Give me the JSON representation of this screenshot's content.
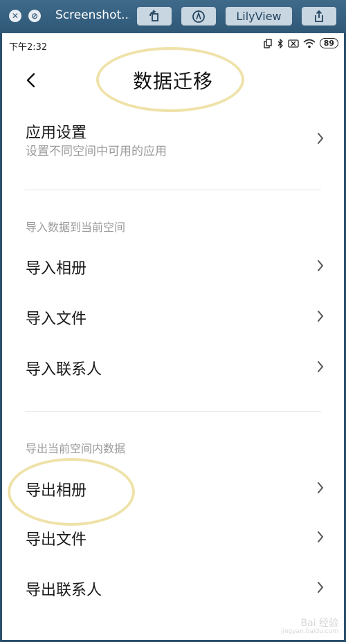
{
  "window": {
    "title": "Screenshot...",
    "lilyview_label": "LilyView",
    "close_glyph": "✕",
    "minimize_glyph": "⊘"
  },
  "status_bar": {
    "time": "下午2:32",
    "battery": "89"
  },
  "header": {
    "title": "数据迁移"
  },
  "app_settings": {
    "label": "应用设置",
    "subtitle": "设置不同空间中可用的应用"
  },
  "import_section": {
    "heading": "导入数据到当前空间",
    "items": [
      {
        "label": "导入相册"
      },
      {
        "label": "导入文件"
      },
      {
        "label": "导入联系人"
      }
    ]
  },
  "export_section": {
    "heading": "导出当前空间内数据",
    "items": [
      {
        "label": "导出相册"
      },
      {
        "label": "导出文件"
      },
      {
        "label": "导出联系人"
      }
    ]
  },
  "watermark": {
    "main": "Bai 经验",
    "sub": "jingyan.baidu.com"
  },
  "colors": {
    "chrome": "#3a6484",
    "highlight_ellipse": "#efe2a9",
    "divider": "#e6e6e6",
    "secondary_text": "#9a9a9a"
  }
}
